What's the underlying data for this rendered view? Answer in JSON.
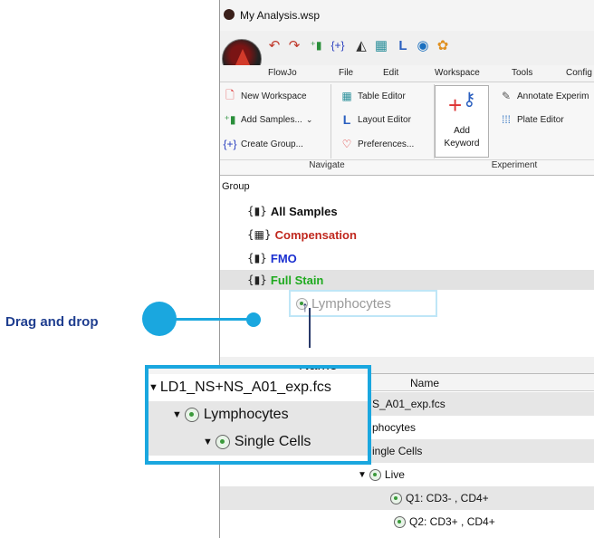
{
  "window": {
    "title": "My Analysis.wsp"
  },
  "menu": [
    "FlowJo",
    "File",
    "Edit",
    "Workspace",
    "Tools",
    "Config"
  ],
  "ribbon": {
    "navigate": {
      "new_workspace": "New Workspace",
      "add_samples": "Add Samples...",
      "create_group": "Create Group...",
      "table_editor": "Table Editor",
      "layout_editor": "Layout Editor",
      "preferences": "Preferences...",
      "label": "Navigate"
    },
    "experiment": {
      "add_keyword_line1": "Add",
      "add_keyword_line2": "Keyword",
      "annotate": "Annotate Experim",
      "plate_editor": "Plate Editor",
      "label": "Experiment"
    }
  },
  "groups": {
    "header": "Group",
    "items": [
      {
        "name": "All Samples",
        "color": "#111111"
      },
      {
        "name": "Compensation",
        "color": "#c0281e"
      },
      {
        "name": "FMO",
        "color": "#1a2fd0"
      },
      {
        "name": "Full Stain",
        "color": "#1faa1f"
      }
    ]
  },
  "drag_ghost": "Lymphocytes",
  "annotation": {
    "label": "Drag and drop"
  },
  "samples": {
    "header_col": "Name",
    "rows": [
      {
        "text": "S_A01_exp.fcs"
      },
      {
        "text": "phocytes"
      },
      {
        "text": "ingle Cells"
      },
      {
        "text": "Live"
      },
      {
        "text": "Q1: CD3- , CD4+"
      },
      {
        "text": "Q2: CD3+ , CD4+"
      }
    ]
  },
  "zoom": {
    "header_partial": "Name",
    "rows": [
      {
        "text": "LD1_NS+NS_A01_exp.fcs"
      },
      {
        "text": "Lymphocytes"
      },
      {
        "text": "Single Cells"
      }
    ]
  },
  "colors": {
    "accent": "#1aa7df",
    "label_blue": "#1f3e8f"
  }
}
